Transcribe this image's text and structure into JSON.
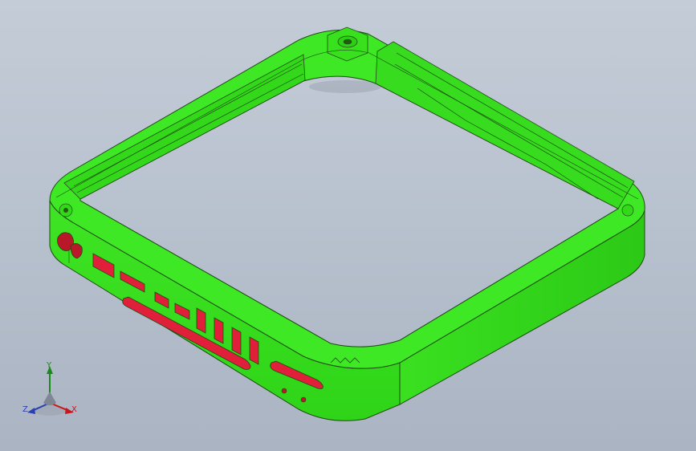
{
  "viewport": {
    "background_top": "#c4ccd7",
    "background_bottom": "#aab4c2"
  },
  "model": {
    "body_color": "#38e81e",
    "edge_color": "#1e4a12",
    "section_color": "#e0203a"
  },
  "triad": {
    "x_label": "X",
    "y_label": "Y",
    "z_label": "Z",
    "x_color": "#c8161d",
    "y_color": "#1b8a1b",
    "z_color": "#2a3fb0"
  }
}
